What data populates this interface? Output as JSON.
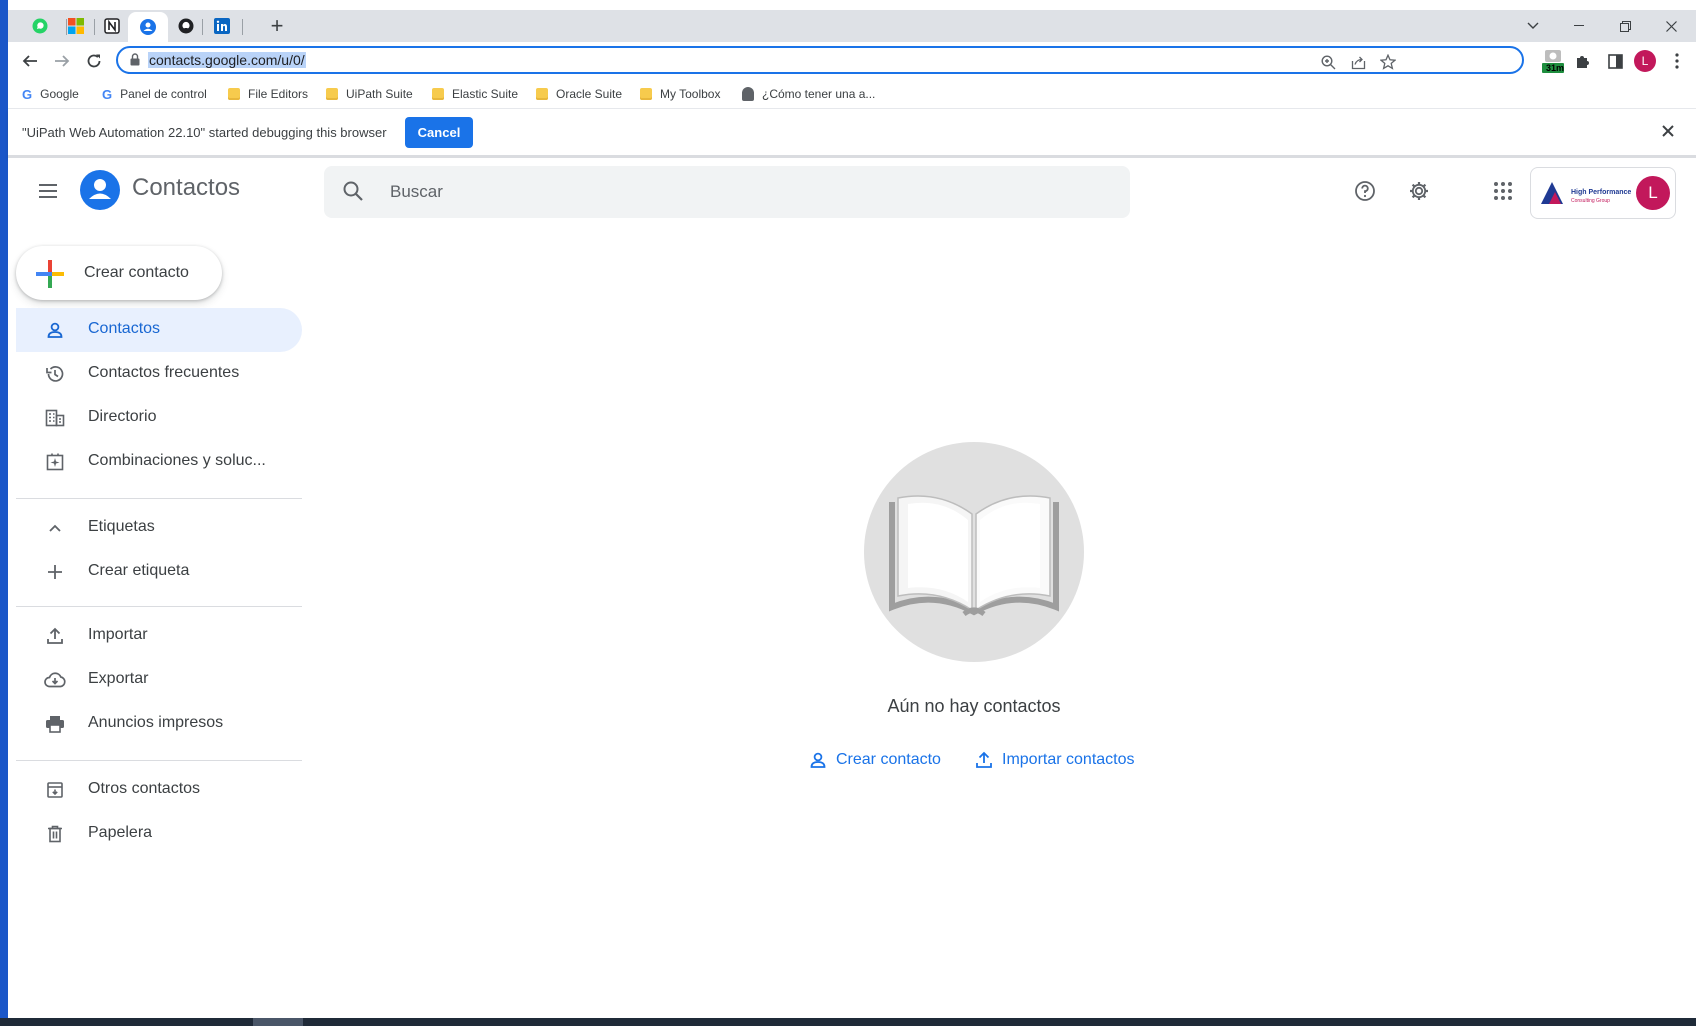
{
  "browser": {
    "tabs": [
      {
        "icon": "whatsapp-icon"
      },
      {
        "icon": "microsoft-icon"
      },
      {
        "icon": "notion-icon"
      },
      {
        "icon": "contacts-icon",
        "active": true
      },
      {
        "icon": "github-icon"
      },
      {
        "icon": "linkedin-icon"
      }
    ],
    "new_tab": "+",
    "url": "contacts.google.com/u/0/",
    "extension_badge": "31m",
    "profile_initial": "L",
    "bookmarks": [
      {
        "label": "Google",
        "type": "google"
      },
      {
        "label": "Panel de control",
        "type": "google"
      },
      {
        "label": "File Editors",
        "type": "folder"
      },
      {
        "label": "UiPath Suite",
        "type": "folder"
      },
      {
        "label": "Elastic Suite",
        "type": "folder"
      },
      {
        "label": "Oracle Suite",
        "type": "folder"
      },
      {
        "label": "My Toolbox",
        "type": "folder"
      },
      {
        "label": "¿Cómo tener una a...",
        "type": "page"
      }
    ]
  },
  "infobar": {
    "text": "\"UiPath Web Automation 22.10\" started debugging this browser",
    "cancel": "Cancel"
  },
  "header": {
    "title": "Contactos",
    "search_placeholder": "Buscar",
    "account_brand": "High Performance",
    "account_sub": "Consulting Group",
    "avatar": "L"
  },
  "sidebar": {
    "create": "Crear contacto",
    "main": [
      {
        "label": "Contactos",
        "icon": "person-icon",
        "active": true
      },
      {
        "label": "Contactos frecuentes",
        "icon": "history-icon"
      },
      {
        "label": "Directorio",
        "icon": "building-icon"
      },
      {
        "label": "Combinaciones y soluc...",
        "icon": "merge-icon"
      }
    ],
    "labels_header": "Etiquetas",
    "create_label": "Crear etiqueta",
    "tools": [
      {
        "label": "Importar",
        "icon": "upload-icon"
      },
      {
        "label": "Exportar",
        "icon": "cloud-download-icon"
      },
      {
        "label": "Anuncios impresos",
        "icon": "printer-icon"
      }
    ],
    "other": [
      {
        "label": "Otros contactos",
        "icon": "archive-icon"
      },
      {
        "label": "Papelera",
        "icon": "trash-icon"
      }
    ]
  },
  "main": {
    "empty_text": "Aún no hay contactos",
    "create_link": "Crear contacto",
    "import_link": "Importar contactos"
  },
  "colors": {
    "accent": "#1a73e8",
    "active_nav_bg": "#e8f0fe",
    "avatar": "#c2185b"
  }
}
